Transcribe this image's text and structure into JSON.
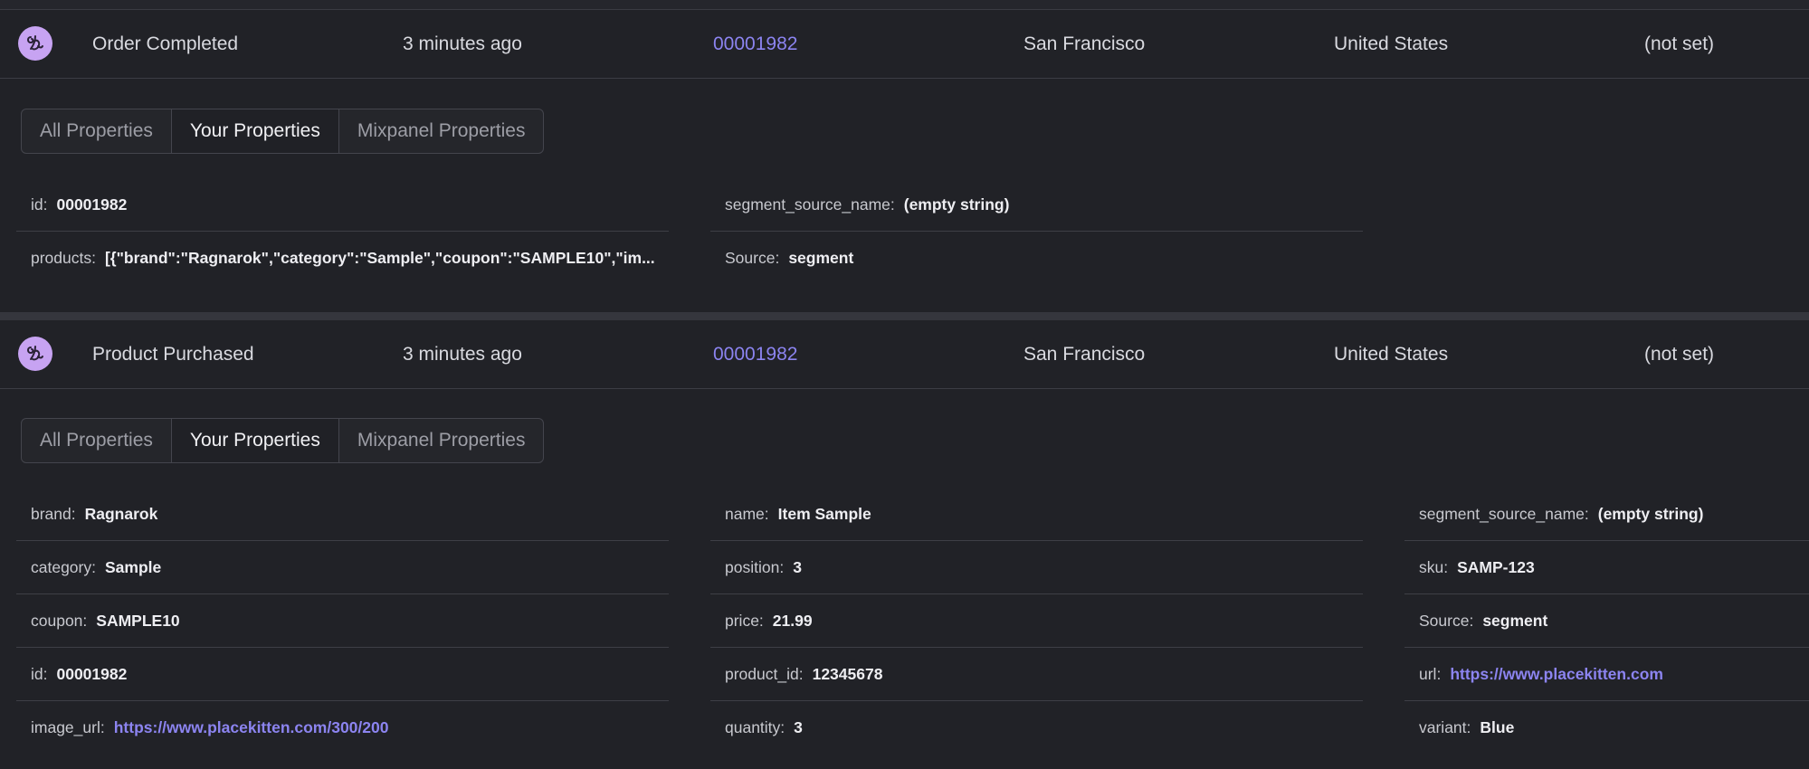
{
  "events": [
    {
      "event_name": "Order Completed",
      "time": "3 minutes ago",
      "distinct_id": "00001982",
      "city": "San Francisco",
      "country": "United States",
      "os": "(not set)",
      "tabs": [
        "All Properties",
        "Your Properties",
        "Mixpanel Properties"
      ],
      "active_tab": "Your Properties",
      "properties": [
        {
          "key": "id:",
          "value": "00001982"
        },
        {
          "key": "products:",
          "value": "[{\"brand\":\"Ragnarok\",\"category\":\"Sample\",\"coupon\":\"SAMPLE10\",\"im..."
        },
        {
          "key": "segment_source_name:",
          "value": "(empty string)"
        },
        {
          "key": "Source:",
          "value": "segment"
        }
      ]
    },
    {
      "event_name": "Product Purchased",
      "time": "3 minutes ago",
      "distinct_id": "00001982",
      "city": "San Francisco",
      "country": "United States",
      "os": "(not set)",
      "tabs": [
        "All Properties",
        "Your Properties",
        "Mixpanel Properties"
      ],
      "active_tab": "Your Properties",
      "properties": [
        {
          "key": "brand:",
          "value": "Ragnarok"
        },
        {
          "key": "category:",
          "value": "Sample"
        },
        {
          "key": "coupon:",
          "value": "SAMPLE10"
        },
        {
          "key": "id:",
          "value": "00001982"
        },
        {
          "key": "image_url:",
          "value": "https://www.placekitten.com/300/200"
        },
        {
          "key": "name:",
          "value": "Item Sample"
        },
        {
          "key": "position:",
          "value": "3"
        },
        {
          "key": "price:",
          "value": "21.99"
        },
        {
          "key": "product_id:",
          "value": "12345678"
        },
        {
          "key": "quantity:",
          "value": "3"
        },
        {
          "key": "segment_source_name:",
          "value": "(empty string)"
        },
        {
          "key": "sku:",
          "value": "SAMP-123"
        },
        {
          "key": "Source:",
          "value": "segment"
        },
        {
          "key": "url:",
          "value": "https://www.placekitten.com"
        },
        {
          "key": "variant:",
          "value": "Blue"
        }
      ]
    }
  ],
  "colors": {
    "background": "#212227",
    "link": "#8c84f0",
    "avatar": "#c7a3f2",
    "border": "#3c3d44"
  },
  "icons": {
    "avatar": "mixpanel-user-avatar-icon"
  }
}
